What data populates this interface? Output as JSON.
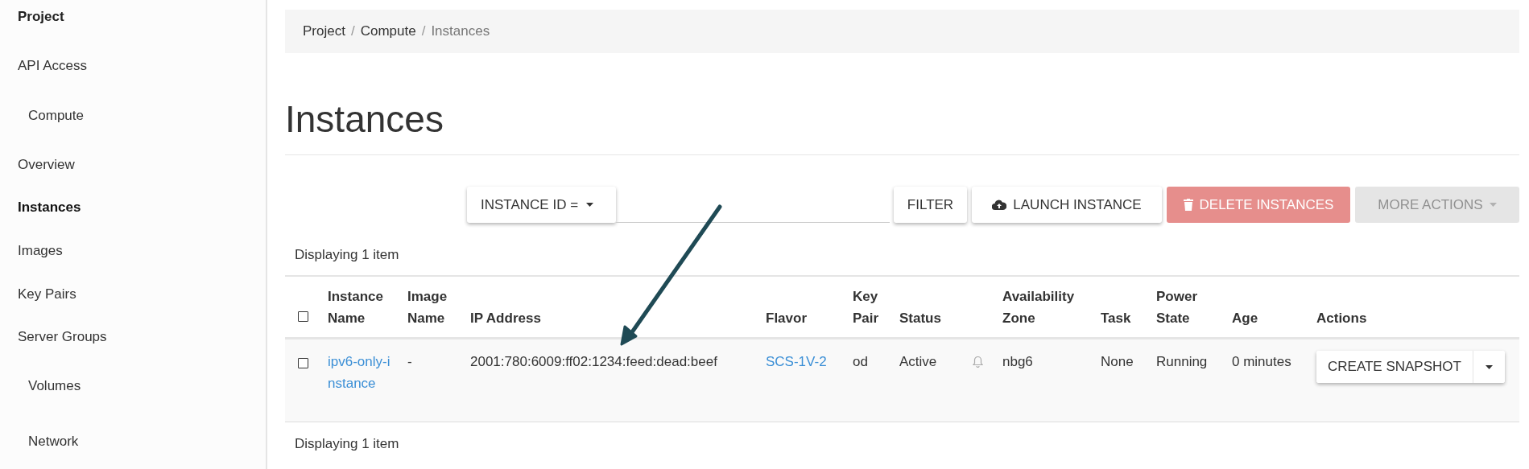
{
  "sidebar": {
    "items": [
      {
        "label": "Project",
        "kind": "header"
      },
      {
        "label": "API Access",
        "kind": "link",
        "selected": false
      },
      {
        "label": "Compute",
        "kind": "section",
        "selected": false
      },
      {
        "label": "Overview",
        "kind": "link",
        "selected": false
      },
      {
        "label": "Instances",
        "kind": "link",
        "selected": true
      },
      {
        "label": "Images",
        "kind": "link",
        "selected": false
      },
      {
        "label": "Key Pairs",
        "kind": "link",
        "selected": false
      },
      {
        "label": "Server Groups",
        "kind": "link",
        "selected": false
      },
      {
        "label": "Volumes",
        "kind": "section",
        "selected": false
      },
      {
        "label": "Network",
        "kind": "section",
        "selected": false
      }
    ]
  },
  "breadcrumb": [
    "Project",
    "Compute",
    "Instances"
  ],
  "separator": "/",
  "page_title": "Instances",
  "toolbar": {
    "filter_field": "INSTANCE ID =",
    "buttons": [
      {
        "label": "FILTER",
        "kind": "filter",
        "disabled": false
      },
      {
        "label": "LAUNCH INSTANCE",
        "kind": "launch",
        "disabled": false
      },
      {
        "label": "DELETE INSTANCES",
        "kind": "danger",
        "disabled": true
      },
      {
        "label": "MORE ACTIONS",
        "kind": "menu",
        "disabled": true
      }
    ]
  },
  "summary_top": "Displaying 1 item",
  "table": {
    "select_all_checked": false,
    "columns": [
      "Instance Name",
      "Image Name",
      "IP Address",
      "Flavor",
      "Key Pair",
      "Status",
      "",
      "Availability Zone",
      "Task",
      "Power State",
      "Age",
      "Actions"
    ],
    "rows": [
      {
        "checked": false,
        "instance_name": "ipv6-only-instance",
        "image_name": "-",
        "ip_address": "2001:780:6009:ff02:1234:feed:dead:beef",
        "flavor": "SCS-1V-2",
        "key_pair": "od",
        "status": "Active",
        "availability_zone": "nbg6",
        "task": "None",
        "power_state": "Running",
        "age": "0 minutes",
        "action": "CREATE SNAPSHOT"
      }
    ]
  },
  "summary_bottom": "Displaying 1 item"
}
